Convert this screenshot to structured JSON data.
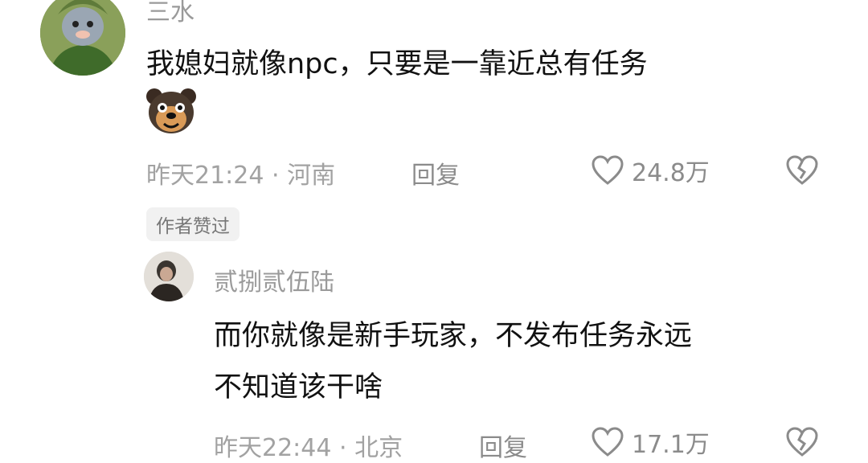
{
  "comments": [
    {
      "username": "三水",
      "text": "我媳妇就像npc，只要是一靠近总有任务",
      "emoji": "dog-face-emoji",
      "time_location": "昨天21:24 · 河南",
      "reply_label": "回复",
      "like_count": "24.8万",
      "author_badge": "作者赞过"
    },
    {
      "username": "贰捌贰伍陆",
      "text_line1": "而你就像是新手玩家，不发布任务永远",
      "text_line2": "不知道该干啥",
      "time_location": "昨天22:44 · 北京",
      "reply_label": "回复",
      "like_count": "17.1万"
    }
  ],
  "colors": {
    "muted_text": "#9a9a9a",
    "badge_bg": "#f1f1f1"
  }
}
